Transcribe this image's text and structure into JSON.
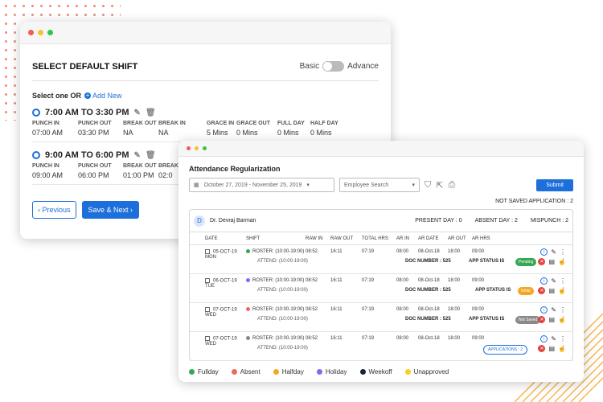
{
  "setup": {
    "title": "SELECT DEFAULT SHIFT",
    "toggle_left": "Basic",
    "toggle_right": "Advance",
    "select_label": "Select one OR",
    "add_new": "Add New",
    "shift_labels": [
      "PUNCH IN",
      "PUNCH OUT",
      "BREAK OUT",
      "BREAK IN",
      "GRACE IN",
      "GRACE OUT",
      "FULL DAY",
      "HALF DAY"
    ],
    "shifts": [
      {
        "name": "7:00 AM TO 3:30 PM",
        "values": [
          "07:00 AM",
          "03:30 PM",
          "NA",
          "NA",
          "5 Mins",
          "0 Mins",
          "0 Mins",
          "0 Mins"
        ]
      },
      {
        "name": "9:00 AM TO 6:00 PM",
        "values": [
          "09:00 AM",
          "06:00 PM",
          "01:00 PM",
          "02:0",
          "",
          "",
          "",
          ""
        ]
      }
    ],
    "prev_button": "‹ Previous",
    "next_button": "Save & Next ›"
  },
  "attendance": {
    "title": "Attendance Regularization",
    "date_range": "October 27, 2019 - November 25, 2019",
    "employee_placeholder": "Employee Search",
    "submit": "Submit",
    "not_saved": "NOT SAVED APPLICATION : 2",
    "employee": {
      "initial": "D",
      "name": "Dr. Devraj Barman",
      "present": "PRESENT DAY : 0",
      "absent": "ABSENT DAY : 2",
      "mispunch": "MISPUNCH : 2"
    },
    "columns": [
      "DATE",
      "SHIFT",
      "RAW IN",
      "RAW OUT",
      "TOTAL HRS",
      "AR IN",
      "AR DATE",
      "AR OUT",
      "AR HRS"
    ],
    "rows": [
      {
        "date": "05-OCT-19 MON",
        "dot": "#34a853",
        "shift": "ROSTER: (10:00-19:00)",
        "attend": "ATTEND: (10:00-19:00)",
        "raw_in": "08:52",
        "raw_out": "16:11",
        "total": "07:19",
        "ar_in": "08:00",
        "ar_date": "08-Oct-18",
        "ar_out": "18:00",
        "ar_hrs": "09:00",
        "doc": "DOC NUMBER : 525",
        "status_label": "APP STATUS IS",
        "status": "Pending",
        "status_color": "#34a853"
      },
      {
        "date": "06-OCT-19 TUE",
        "dot": "#7c6cf0",
        "shift": "ROSTER: (10:00-19:00)",
        "attend": "ATTEND: (10:00-19:00)",
        "raw_in": "08:52",
        "raw_out": "16:11",
        "total": "07:19",
        "ar_in": "08:00",
        "ar_date": "08-Oct-18",
        "ar_out": "18:00",
        "ar_hrs": "09:00",
        "doc": "DOC NUMBER : 525",
        "status_label": "APP STATUS IS",
        "status": "Initial",
        "status_color": "#f5a623"
      },
      {
        "date": "07-OCT-19 WED",
        "dot": "#ea6b5c",
        "shift": "ROSTER: (10:00-19:00)",
        "attend": "ATTEND: (10:00-19:00)",
        "raw_in": "08:52",
        "raw_out": "16:11",
        "total": "07:19",
        "ar_in": "08:00",
        "ar_date": "08-Oct-18",
        "ar_out": "18:00",
        "ar_hrs": "09:00",
        "doc": "DOC NUMBER : 525",
        "status_label": "APP STATUS IS",
        "status": "Not Saved",
        "status_color": "#8a8a8a"
      },
      {
        "date": "07-OCT-19 WED",
        "dot": "#888888",
        "shift": "ROSTER: (10:00-19:00)",
        "attend": "ATTEND: (10:00-19:00)",
        "raw_in": "08:52",
        "raw_out": "16:11",
        "total": "07:19",
        "ar_in": "08:00",
        "ar_date": "08-Oct-18",
        "ar_out": "18:00",
        "ar_hrs": "09:00",
        "applications": "APPLICATIONS : 2"
      }
    ],
    "legend": [
      {
        "label": "Fullday",
        "color": "#34a853"
      },
      {
        "label": "Absent",
        "color": "#ea6b5c"
      },
      {
        "label": "Halfday",
        "color": "#f5a623"
      },
      {
        "label": "Holiday",
        "color": "#7c6cf0"
      },
      {
        "label": "Weekoff",
        "color": "#1a2340"
      },
      {
        "label": "Unapproved",
        "color": "#f7d117"
      }
    ]
  }
}
